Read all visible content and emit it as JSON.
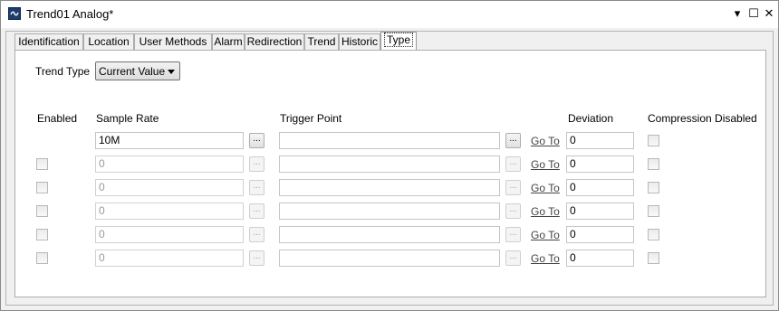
{
  "window": {
    "title": "Trend01 Analog*",
    "controls": [
      "▾",
      "☐",
      "✕"
    ]
  },
  "tabs": [
    "Identification",
    "Location",
    "User Methods",
    "Alarm",
    "Redirection",
    "Trend",
    "Historic",
    "Type"
  ],
  "active_tab": "Type",
  "trend_type": {
    "label": "Trend Type",
    "value": "Current Value"
  },
  "headers": {
    "enabled": "Enabled",
    "sample_rate": "Sample Rate",
    "trigger_point": "Trigger Point",
    "deviation": "Deviation",
    "compression_disabled": "Compression Disabled"
  },
  "browse_label": "...",
  "goto_label": "Go To",
  "rows": [
    {
      "sample_rate": "10M",
      "trigger_point": "",
      "deviation": "0"
    },
    {
      "sample_rate": "0",
      "trigger_point": "",
      "deviation": "0"
    },
    {
      "sample_rate": "0",
      "trigger_point": "",
      "deviation": "0"
    },
    {
      "sample_rate": "0",
      "trigger_point": "",
      "deviation": "0"
    },
    {
      "sample_rate": "0",
      "trigger_point": "",
      "deviation": "0"
    },
    {
      "sample_rate": "0",
      "trigger_point": "",
      "deviation": "0"
    }
  ]
}
